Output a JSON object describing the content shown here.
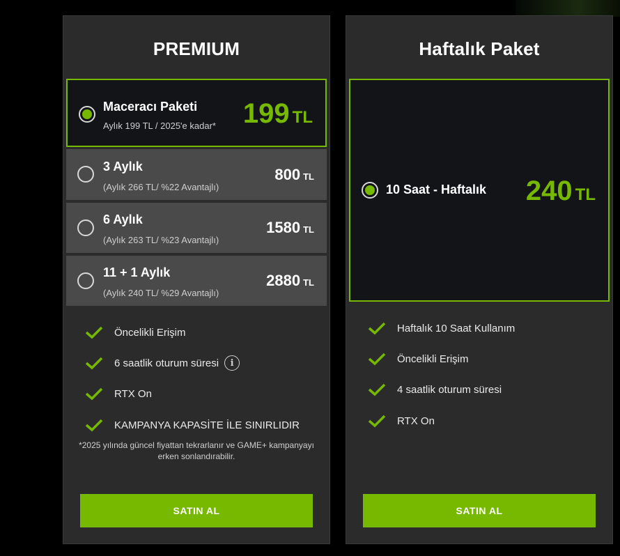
{
  "colors": {
    "accent": "#76b900",
    "card_bg": "#2b2b2b",
    "plan_bg": "#4a4a4a",
    "selected_bg": "#121418"
  },
  "premium": {
    "title": "PREMIUM",
    "plans": [
      {
        "name": "Maceracı Paketi",
        "sub": "Aylık 199 TL / 2025'e kadar*",
        "price": "199",
        "currency": "TL",
        "selected": true
      },
      {
        "name": "3 Aylık",
        "sub": "(Aylık 266 TL/ %22 Avantajlı)",
        "price": "800",
        "currency": "TL",
        "selected": false
      },
      {
        "name": "6 Aylık",
        "sub": "(Aylık 263 TL/ %23 Avantajlı)",
        "price": "1580",
        "currency": "TL",
        "selected": false
      },
      {
        "name": "11 + 1 Aylık",
        "sub": "(Aylık 240 TL/ %29 Avantajlı)",
        "price": "2880",
        "currency": "TL",
        "selected": false
      }
    ],
    "features": [
      "Öncelikli Erişim",
      "6 saatlik oturum süresi",
      "RTX On",
      "KAMPANYA KAPASİTE İLE SINIRLIDIR"
    ],
    "info_icon": "i",
    "footnote": "*2025 yılında güncel fiyattan tekrarlanır ve GAME+ kampanyayı erken sonlandırabilir.",
    "buy_label": "SATIN AL"
  },
  "weekly": {
    "title": "Haftalık Paket",
    "plan": {
      "name": "10 Saat - Haftalık",
      "price": "240",
      "currency": "TL",
      "selected": true
    },
    "features": [
      "Haftalık 10 Saat Kullanım",
      "Öncelikli Erişim",
      "4 saatlik oturum süresi",
      "RTX On"
    ],
    "buy_label": "SATIN AL"
  }
}
